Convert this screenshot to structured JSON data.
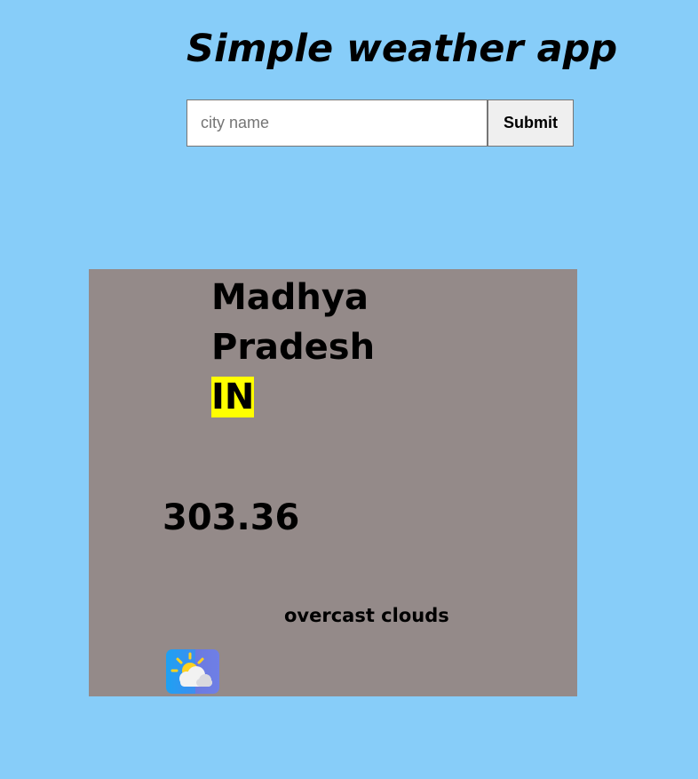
{
  "app": {
    "title": "Simple weather app"
  },
  "search": {
    "placeholder": "city name",
    "value": "",
    "submit_label": "Submit"
  },
  "weather": {
    "location_name": "Madhya Pradesh",
    "country_code": "IN",
    "temperature": "303.36",
    "description": "overcast clouds",
    "icon": "partly-cloudy-icon"
  },
  "colors": {
    "page_background": "#87cdf9",
    "card_background": "#948a89",
    "country_highlight": "#ffff00"
  }
}
